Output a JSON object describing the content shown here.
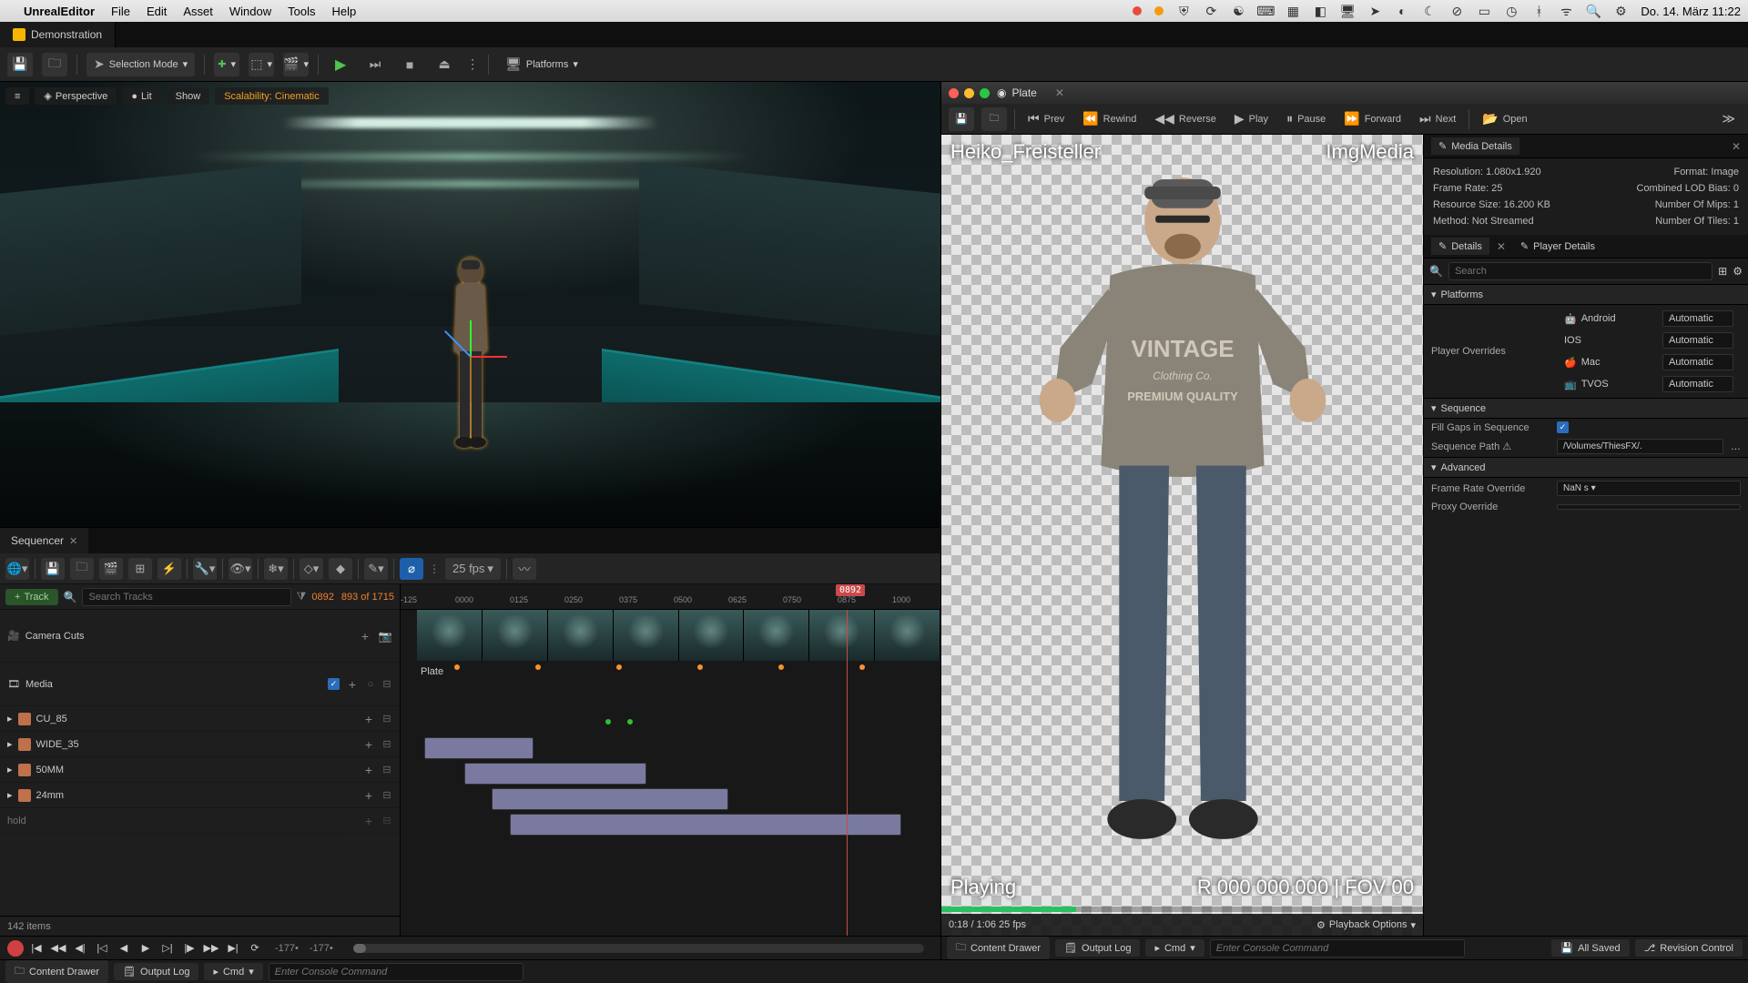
{
  "menubar": {
    "app": "UnrealEditor",
    "items": [
      "File",
      "Edit",
      "Asset",
      "Window",
      "Tools",
      "Help"
    ],
    "clock": "Do. 14. März  11:22"
  },
  "doc_tab": {
    "title": "Demonstration"
  },
  "toolbar": {
    "selection_mode": "Selection Mode",
    "platforms": "Platforms"
  },
  "viewport": {
    "perspective": "Perspective",
    "lit": "Lit",
    "show": "Show",
    "scalability": "Scalability: Cinematic"
  },
  "sequencer": {
    "tab": "Sequencer",
    "fps": "25 fps",
    "track_btn": "Track",
    "search_ph": "Search Tracks",
    "frame_current": "0892",
    "frame_readout": "893 of 1715",
    "playhead": "0892",
    "ticks": [
      "-125",
      "0000",
      "0125",
      "0250",
      "0375",
      "0500",
      "0625",
      "0750",
      "0875",
      "1000"
    ],
    "tracks": {
      "camera_cuts": "Camera Cuts",
      "media": "Media",
      "plate": "Plate",
      "shots": [
        "CU_85",
        "WIDE_35",
        "50MM",
        "24mm",
        "hold"
      ]
    },
    "items_count": "142 items",
    "left_time": "-177•",
    "right_time": "-177•"
  },
  "plate": {
    "title": "Plate",
    "toolbar": {
      "prev": "Prev",
      "rewind": "Rewind",
      "reverse": "Reverse",
      "play": "Play",
      "pause": "Pause",
      "forward": "Forward",
      "next": "Next",
      "open": "Open"
    },
    "label_left": "Heiko_Freisteller",
    "label_right": "ImgMedia",
    "status": "Playing",
    "status_right": "R 000 000.000 | FOV 00",
    "time": "0:18 / 1:06  25 fps",
    "playback_options": "Playback Options"
  },
  "media_details": {
    "tab": "Media Details",
    "resolution_l": "Resolution: 1.080x1.920",
    "format_l": "Format: Image",
    "framerate_l": "Frame Rate: 25",
    "lodbias_l": "Combined LOD Bias: 0",
    "resize_l": "Resource Size: 16.200 KB",
    "mips_l": "Number Of Mips: 1",
    "method_l": "Method: Not Streamed",
    "tiles_l": "Number Of Tiles: 1"
  },
  "details": {
    "tab": "Details",
    "player_tab": "Player Details",
    "search_ph": "Search",
    "sections": {
      "platforms": "Platforms",
      "player_overrides": "Player Overrides",
      "sequence": "Sequence",
      "advanced": "Advanced"
    },
    "platforms_list": [
      {
        "name": "Android",
        "val": "Automatic"
      },
      {
        "name": "IOS",
        "val": "Automatic"
      },
      {
        "name": "Mac",
        "val": "Automatic"
      },
      {
        "name": "TVOS",
        "val": "Automatic"
      }
    ],
    "fill_gaps": "Fill Gaps in Sequence",
    "seq_path": "Sequence Path",
    "seq_path_val": "/Volumes/ThiesFX/.",
    "frame_rate_override": "Frame Rate Override",
    "frame_rate_val": "NaN s",
    "proxy_override": "Proxy Override"
  },
  "statusbar": {
    "content_drawer": "Content Drawer",
    "output_log": "Output Log",
    "cmd": "Cmd",
    "cmd_ph": "Enter Console Command",
    "all_saved": "All Saved",
    "revision": "Revision Control"
  }
}
